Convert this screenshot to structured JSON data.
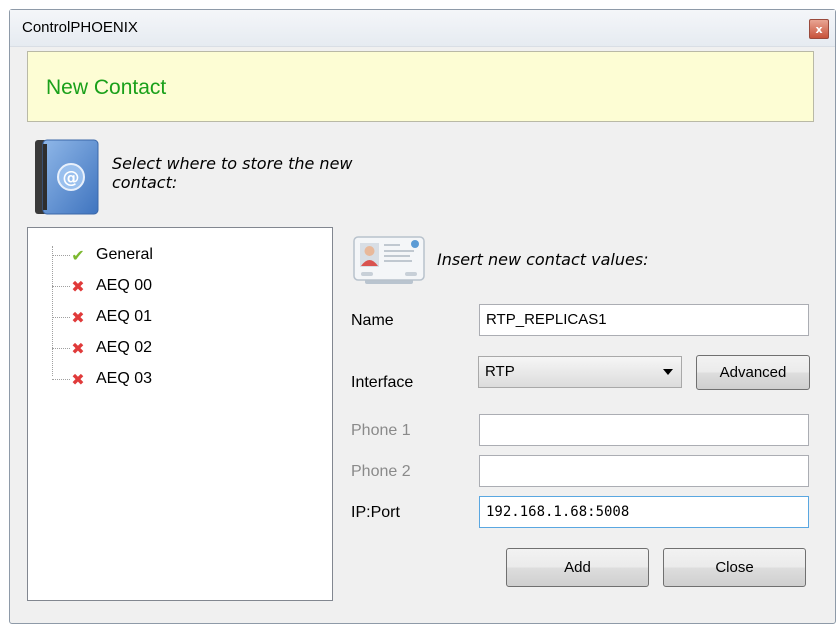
{
  "window": {
    "title": "ControlPHOENIX",
    "close_glyph": "x"
  },
  "banner": {
    "title": "New Contact"
  },
  "store_section": {
    "icon": "address-book-icon",
    "instruction": "Select where to store the new contact:",
    "tree": [
      {
        "label": "General",
        "status": "check",
        "status_glyph": "✔"
      },
      {
        "label": "AEQ 00",
        "status": "error",
        "status_glyph": "✖"
      },
      {
        "label": "AEQ 01",
        "status": "error",
        "status_glyph": "✖"
      },
      {
        "label": "AEQ 02",
        "status": "error",
        "status_glyph": "✖"
      },
      {
        "label": "AEQ 03",
        "status": "error",
        "status_glyph": "✖"
      }
    ]
  },
  "contact_section": {
    "icon": "contact-card-icon",
    "instruction": "Insert new contact values:",
    "name": {
      "label": "Name",
      "value": "RTP_REPLICAS1"
    },
    "interface": {
      "label": "Interface",
      "value": "RTP",
      "advanced_label": "Advanced"
    },
    "phone1": {
      "label": "Phone 1",
      "value": ""
    },
    "phone2": {
      "label": "Phone 2",
      "value": ""
    },
    "ip_port": {
      "label": "IP:Port",
      "value": "192.168.1.68:5008"
    }
  },
  "buttons": {
    "add": "Add",
    "close": "Close"
  },
  "colors": {
    "banner_bg": "#fdfdd4",
    "banner_text": "#1aa01a",
    "check": "#7cb82f",
    "error": "#e03a3a",
    "disabled_label": "#8a8a8a"
  }
}
